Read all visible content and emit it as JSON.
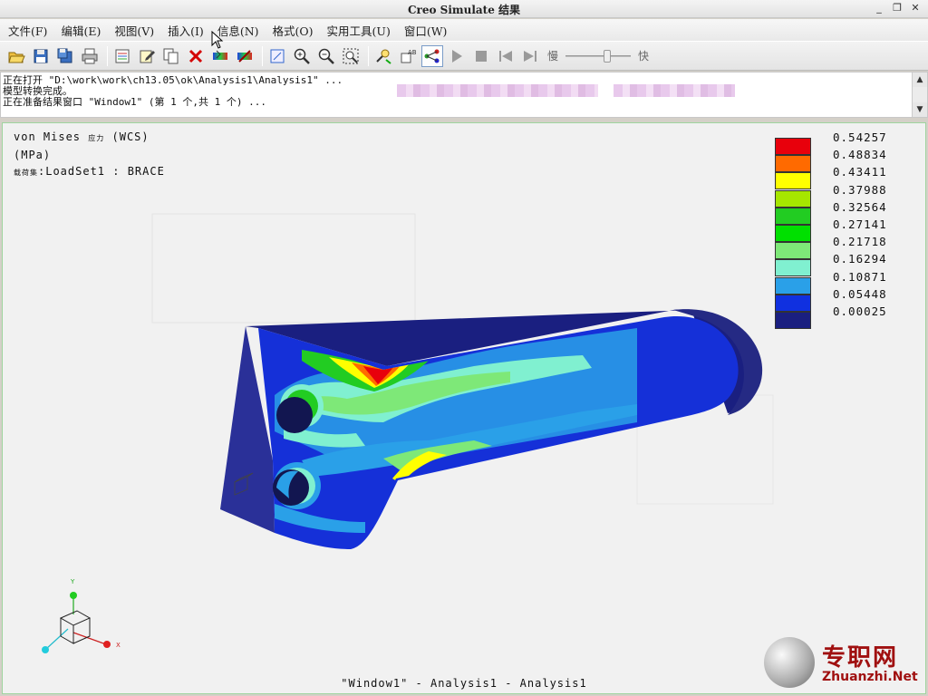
{
  "window": {
    "title": "Creo Simulate 结果",
    "minimize": "_",
    "restore": "❐",
    "close": "✕"
  },
  "menu": [
    "文件(F)",
    "编辑(E)",
    "视图(V)",
    "插入(I)",
    "信息(N)",
    "格式(O)",
    "实用工具(U)",
    "窗口(W)"
  ],
  "toolbar": {
    "icons": [
      "open-icon",
      "save-icon",
      "save-as-icon",
      "print-icon",
      "copy-window-icon",
      "edit-icon",
      "copy-icon",
      "delete-icon",
      "show-icon",
      "hide-icon",
      "zoom-fit-icon",
      "zoom-in-icon",
      "zoom-out-icon",
      "zoom-window-icon",
      "query-icon",
      "dynamic-query-icon",
      "link-icon",
      "play-icon",
      "stop-icon",
      "first-frame-icon",
      "last-frame-icon"
    ],
    "slow_label": "慢",
    "fast_label": "快",
    "speed_slider_value": 0.65
  },
  "messages": {
    "line1": "正在打开 \"D:\\work\\work\\ch13.05\\ok\\Analysis1\\Analysis1\" ...",
    "line2": "模型转换完成。",
    "line3": "正在准备结果窗口 \"Window1\" (第 1 个,共 1 个) ..."
  },
  "graphics": {
    "result_title": "von Mises",
    "result_title_cn": "应力",
    "coord_system": "(WCS)",
    "units": "(MPa)",
    "loadset_prefix": "载荷集",
    "loadset": ":LoadSet1 :  BRACE",
    "caption": "\"Window1\" - Analysis1 - Analysis1",
    "triad": {
      "x": "X",
      "y": "Y"
    }
  },
  "legend": {
    "values": [
      "0.54257",
      "0.48834",
      "0.43411",
      "0.37988",
      "0.32564",
      "0.27141",
      "0.21718",
      "0.16294",
      "0.10871",
      "0.05448",
      "0.00025"
    ],
    "colors": [
      "#e8000c",
      "#ff6a00",
      "#ffff00",
      "#a6e600",
      "#22cc22",
      "#00e000",
      "#7ee878",
      "#80f0d0",
      "#2aa0e8",
      "#1030e0",
      "#1a1f80"
    ]
  },
  "logo": {
    "cn": "专职网",
    "en": "Zhuanzhi.Net"
  }
}
